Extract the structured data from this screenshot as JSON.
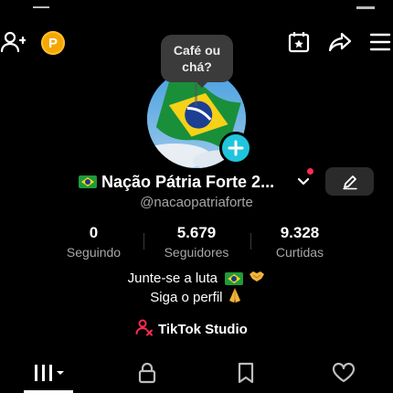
{
  "header": {
    "coin_label": "P"
  },
  "note_bubble": {
    "text": "Café ou chá?"
  },
  "profile": {
    "display_name": "Nação Pátria Forte 2...",
    "username": "@nacaopatriaforte"
  },
  "stats": [
    {
      "value": "0",
      "label": "Seguindo"
    },
    {
      "value": "5.679",
      "label": "Seguidores"
    },
    {
      "value": "9.328",
      "label": "Curtidas"
    }
  ],
  "bio": {
    "line1": "Junte-se a luta",
    "line2": "Siga o perfil"
  },
  "studio": {
    "label": "TikTok Studio"
  },
  "colors": {
    "accent_red": "#fe2c55",
    "coin": "#f5a700",
    "add_badge": "#20c5dd",
    "secondary_text": "#a7a7a7"
  },
  "icons": {
    "top_left": "add-friend-icon",
    "top_right": [
      "calendar-star-icon",
      "share-icon",
      "menu-icon"
    ],
    "tabs": [
      "grid-icon",
      "lock-icon",
      "bookmark-icon",
      "heart-icon"
    ]
  }
}
